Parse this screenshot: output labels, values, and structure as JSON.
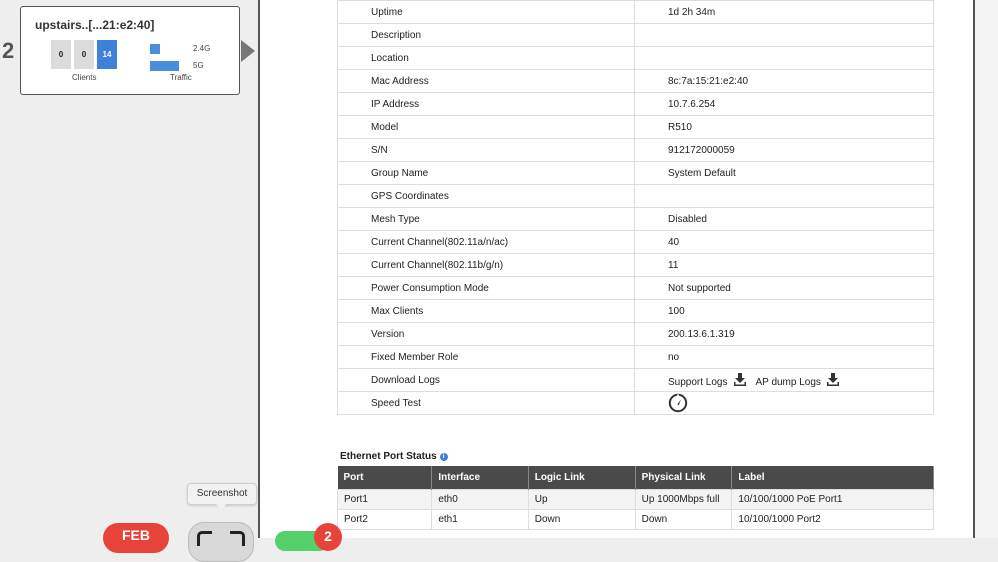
{
  "ap_card": {
    "row_number": "2",
    "name": "upstairs..[...21:e2:40]",
    "client_counts": [
      "0",
      "0",
      "14"
    ],
    "clients_label": "Clients",
    "traffic_label": "Traffic",
    "band_24": "2.4G",
    "band_5": "5G",
    "accent_color": "#3d82d8"
  },
  "details": [
    {
      "label": "Uptime",
      "value": "1d 2h 34m"
    },
    {
      "label": "Description",
      "value": ""
    },
    {
      "label": "Location",
      "value": ""
    },
    {
      "label": "Mac Address",
      "value": "8c:7a:15:21:e2:40"
    },
    {
      "label": "IP Address",
      "value": "10.7.6.254"
    },
    {
      "label": "Model",
      "value": "R510"
    },
    {
      "label": "S/N",
      "value": "912172000059"
    },
    {
      "label": "Group Name",
      "value": "System Default"
    },
    {
      "label": "GPS Coordinates",
      "value": ""
    },
    {
      "label": "Mesh Type",
      "value": "Disabled"
    },
    {
      "label": "Current Channel(802.11a/n/ac)",
      "value": "40"
    },
    {
      "label": "Current Channel(802.11b/g/n)",
      "value": "11"
    },
    {
      "label": "Power Consumption Mode",
      "value": "Not supported"
    },
    {
      "label": "Max Clients",
      "value": "100"
    },
    {
      "label": "Version",
      "value": "200.13.6.1.319"
    },
    {
      "label": "Fixed Member Role",
      "value": "no"
    }
  ],
  "download_logs": {
    "label": "Download Logs",
    "support_logs": "Support Logs",
    "ap_dump_logs": "AP dump Logs",
    "icon": "download-icon"
  },
  "speed_test": {
    "label": "Speed Test",
    "icon": "speedometer-icon"
  },
  "ethernet": {
    "title": "Ethernet Port Status",
    "info_icon": "info-icon",
    "columns": [
      "Port",
      "Interface",
      "Logic Link",
      "Physical Link",
      "Label"
    ],
    "rows": [
      [
        "Port1",
        "eth0",
        "Up",
        "Up 1000Mbps full",
        "10/100/1000 PoE Port1"
      ],
      [
        "Port2",
        "eth1",
        "Down",
        "Down",
        "10/100/1000 Port2"
      ]
    ]
  },
  "overlay": {
    "tooltip": "Screenshot",
    "feb_label": "FEB",
    "badge_count": "2"
  }
}
